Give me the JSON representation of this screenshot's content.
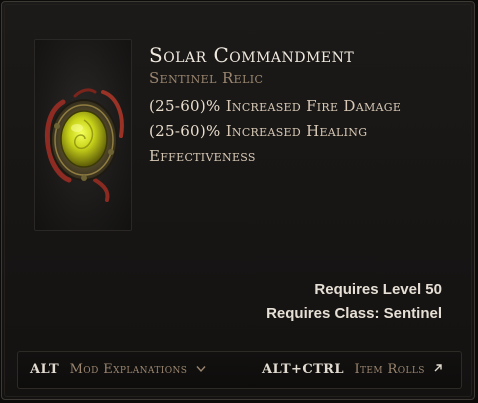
{
  "item": {
    "name": "Solar Commandment",
    "type": "Sentinel Relic",
    "affixes": [
      {
        "range": "(25-60)%",
        "text": "Increased Fire Damage"
      },
      {
        "range": "(25-60)%",
        "text": "Increased Healing Effectiveness"
      }
    ],
    "icon": "golden-sun-relic-icon"
  },
  "requirements": {
    "level": "Requires Level 50",
    "class": "Requires Class: Sentinel"
  },
  "footer": {
    "mod_key": "ALT",
    "mod_action": "Mod Explanations",
    "mod_glyph": "chevron-down-icon",
    "rolls_key": "ALT+CTRL",
    "rolls_action": "Item Rolls",
    "rolls_glyph": "arrow-up-right-icon"
  },
  "colors": {
    "name": "#efe9df",
    "subtitle": "#9a8670",
    "affix": "#d7c9b6",
    "background": "#171514"
  }
}
